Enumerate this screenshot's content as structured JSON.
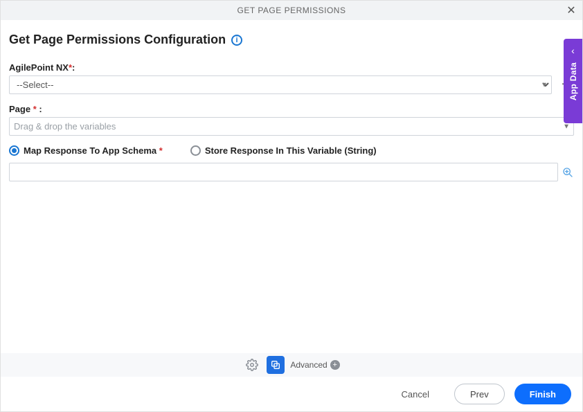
{
  "titlebar": {
    "title": "GET PAGE PERMISSIONS"
  },
  "header": {
    "title": "Get Page Permissions Configuration"
  },
  "fields": {
    "agilepoint": {
      "label": "AgilePoint NX",
      "required": "*",
      "suffix": ":",
      "selected": "--Select--"
    },
    "page": {
      "label": "Page",
      "required": "*",
      "suffix": ":",
      "placeholder": "Drag & drop the variables",
      "value": ""
    }
  },
  "response": {
    "map_label": "Map Response To App Schema",
    "map_required": "*",
    "store_label": "Store Response In This Variable (String)",
    "selected": "map",
    "value": ""
  },
  "side_tab": {
    "label": "App Data"
  },
  "advanced": {
    "label": "Advanced"
  },
  "footer": {
    "cancel": "Cancel",
    "prev": "Prev",
    "finish": "Finish"
  }
}
